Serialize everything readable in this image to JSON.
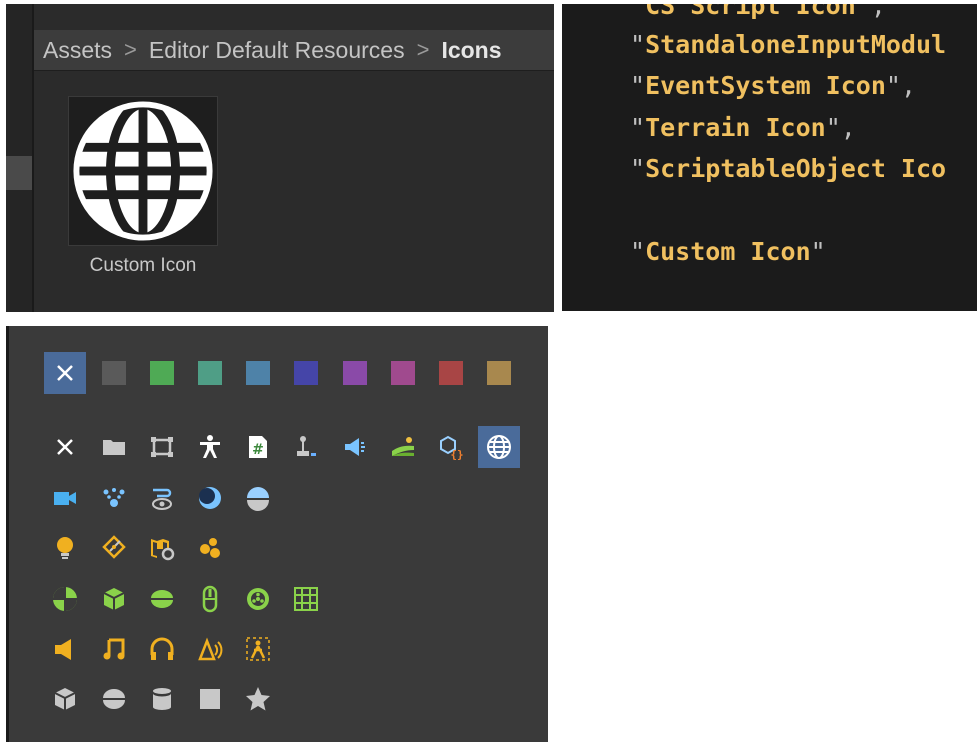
{
  "project_window": {
    "breadcrumb": [
      "Assets",
      "Editor Default Resources",
      "Icons"
    ],
    "separator": ">",
    "asset": {
      "label": "Custom Icon",
      "icon": "globe-icon"
    }
  },
  "code_editor": {
    "lines": [
      {
        "text": "CS Script Icon",
        "trail": ","
      },
      {
        "text": "StandaloneInputModul",
        "trail": ""
      },
      {
        "text": "EventSystem Icon",
        "trail": ","
      },
      {
        "text": "Terrain Icon",
        "trail": ","
      },
      {
        "text": "ScriptableObject Ico",
        "trail": ""
      },
      {
        "text": "",
        "trail": ""
      },
      {
        "text": "Custom Icon",
        "trail": ""
      }
    ],
    "string_color": "#f0c060"
  },
  "icon_picker": {
    "colors": [
      "none",
      "#5a5a5a",
      "#4faa55",
      "#4f9e86",
      "#4e82a8",
      "#4545a8",
      "#8a4aa8",
      "#a04a8e",
      "#a84545",
      "#a8884e"
    ],
    "icon_rows": [
      [
        "none-icon",
        "folder-icon",
        "rect-transform-icon",
        "humanoid-icon",
        "script-icon",
        "joystick-icon",
        "megaphone-icon",
        "terrain-icon",
        "scriptable-object-icon",
        "globe-icon"
      ],
      [
        "camera-icon",
        "particle-system-icon",
        "eye-path-icon",
        "half-moon-icon",
        "half-sphere-icon"
      ],
      [
        "light-bulb-icon",
        "light-probe-icon",
        "map-gear-icon",
        "blobs-icon"
      ],
      [
        "sphere-collider-icon",
        "box-collider-icon",
        "capsule-icon",
        "wheel-outline-icon",
        "wheel-icon",
        "grid-icon"
      ],
      [
        "audio-source-icon",
        "music-note-icon",
        "headphones-icon",
        "audio-cone-icon",
        "audio-person-icon"
      ],
      [
        "cube-icon",
        "sphere-icon",
        "cylinder-icon",
        "square-icon",
        "star-icon"
      ]
    ],
    "selected_color": "none",
    "selected_icon": "globe-icon",
    "selection_color": "#4a6b9a"
  }
}
